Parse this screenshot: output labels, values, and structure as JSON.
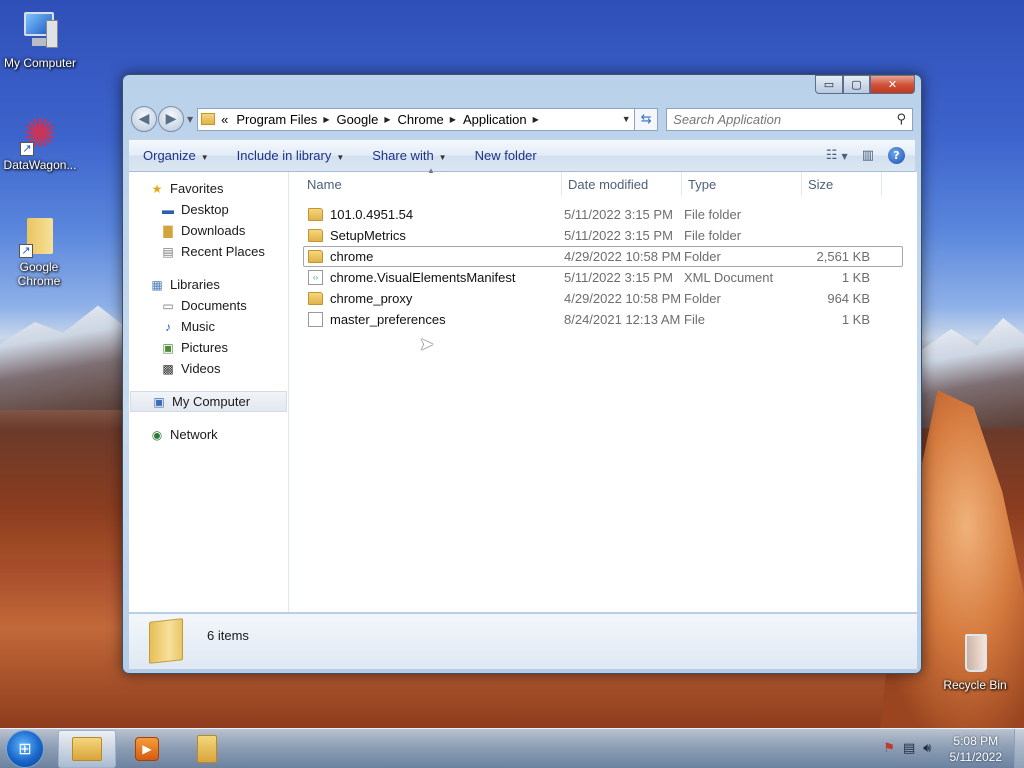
{
  "desktop": {
    "icons": [
      {
        "label": "My Computer"
      },
      {
        "label": "DataWagon..."
      },
      {
        "label": "Google Chrome"
      },
      {
        "label": "Recycle Bin"
      }
    ]
  },
  "window": {
    "caption_buttons": {
      "minimize": "▭",
      "maximize": "▢",
      "close": "✕"
    },
    "address": {
      "overflow": "«",
      "crumbs": [
        "Program Files",
        "Google",
        "Chrome",
        "Application"
      ],
      "separator": "▶"
    },
    "search": {
      "placeholder": "Search Application"
    },
    "toolbar": {
      "organize": "Organize",
      "include_in_library": "Include in library",
      "share_with": "Share with",
      "new_folder": "New folder"
    },
    "nav": {
      "favorites": "Favorites",
      "desktop": "Desktop",
      "downloads": "Downloads",
      "recent_places": "Recent Places",
      "libraries": "Libraries",
      "documents": "Documents",
      "music": "Music",
      "pictures": "Pictures",
      "videos": "Videos",
      "my_computer": "My Computer",
      "network": "Network"
    },
    "columns": {
      "name": "Name",
      "date": "Date modified",
      "type": "Type",
      "size": "Size"
    },
    "files": [
      {
        "name": "101.0.4951.54",
        "date": "5/11/2022 3:15 PM",
        "type": "File folder",
        "size": "",
        "icon": "folder-icon"
      },
      {
        "name": "SetupMetrics",
        "date": "5/11/2022 3:15 PM",
        "type": "File folder",
        "size": "",
        "icon": "folder-icon"
      },
      {
        "name": "chrome",
        "date": "4/29/2022 10:58 PM",
        "type": "Folder",
        "size": "2,561 KB",
        "icon": "folder-icon"
      },
      {
        "name": "chrome.VisualElementsManifest",
        "date": "5/11/2022 3:15 PM",
        "type": "XML Document",
        "size": "1 KB",
        "icon": "xml-file-icon"
      },
      {
        "name": "chrome_proxy",
        "date": "4/29/2022 10:58 PM",
        "type": "Folder",
        "size": "964 KB",
        "icon": "folder-icon"
      },
      {
        "name": "master_preferences",
        "date": "8/24/2021 12:13 AM",
        "type": "File",
        "size": "1 KB",
        "icon": "file-icon"
      }
    ],
    "details": {
      "count": "6 items"
    }
  },
  "taskbar": {
    "time": "5:08 PM",
    "date": "5/11/2022"
  }
}
